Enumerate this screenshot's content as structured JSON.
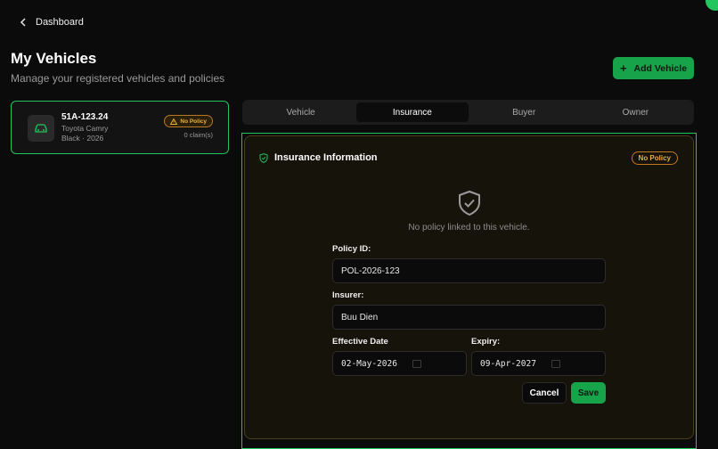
{
  "header": {
    "back_label": "Dashboard",
    "title": "My Vehicles",
    "subtitle": "Manage your registered vehicles and policies",
    "add_button_label": "Add Vehicle"
  },
  "vehicle": {
    "plate": "51A-123.24",
    "model": "Toyota Camry",
    "meta": "Black · 2026",
    "status_badge": "No Policy",
    "claims": "0 claim(s)"
  },
  "tabs": [
    {
      "label": "Vehicle",
      "active": false
    },
    {
      "label": "Insurance",
      "active": true
    },
    {
      "label": "Buyer",
      "active": false
    },
    {
      "label": "Owner",
      "active": false
    }
  ],
  "insurance": {
    "title": "Insurance Information",
    "status_badge": "No Policy",
    "empty_message": "No policy linked to this vehicle.",
    "policy_id_label": "Policy ID:",
    "policy_id_value": "POL-2026-123",
    "insurer_label": "Insurer:",
    "insurer_value": "Buu Dien",
    "effective_label": "Effective Date",
    "effective_value": "02-May-2026",
    "expiry_label": "Expiry:",
    "expiry_value": "09-Apr-2027",
    "cancel_label": "Cancel",
    "save_label": "Save"
  },
  "colors": {
    "accent": "#22c55e",
    "warning": "#f0a83a",
    "background": "#0b0b0b"
  }
}
